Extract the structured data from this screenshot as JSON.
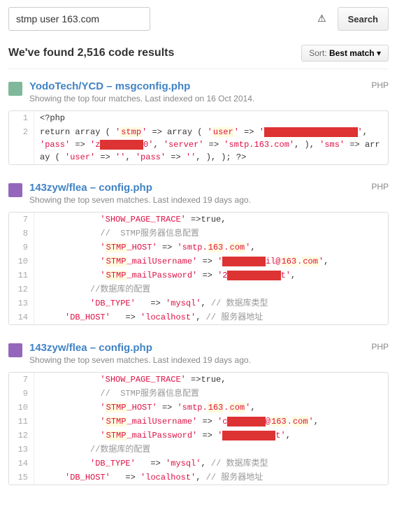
{
  "search": {
    "value": "stmp user 163.com",
    "button": "Search"
  },
  "results_heading": "We've found 2,516 code results",
  "sort": {
    "label": "Sort:",
    "value": "Best match"
  },
  "results": [
    {
      "repo": "YodoTech/YCD",
      "path": "msgconfig.php",
      "sub": "Showing the top four matches. Last indexed on 16 Oct 2014.",
      "lang": "PHP",
      "avatar": "a1",
      "lines": [
        {
          "n": "1",
          "segs": [
            {
              "t": "<?php",
              "c": "tag"
            }
          ]
        },
        {
          "n": "2",
          "segs": [
            {
              "t": "return array ( ",
              "c": "kw"
            },
            {
              "t": "'",
              "c": "str"
            },
            {
              "t": "stmp",
              "c": "str hl"
            },
            {
              "t": "'",
              "c": "str"
            },
            {
              "t": " => array ( ",
              "c": "op"
            },
            {
              "t": "'",
              "c": "str"
            },
            {
              "t": "user",
              "c": "str hl"
            },
            {
              "t": "'",
              "c": "str"
            },
            {
              "t": " => ",
              "c": "op"
            },
            {
              "t": "'",
              "c": "str"
            },
            {
              "t": "██████████████████",
              "c": "red"
            },
            {
              "t": "'",
              "c": "str"
            },
            {
              "t": ", ",
              "c": "op"
            },
            {
              "t": "'pass'",
              "c": "str"
            },
            {
              "t": " => ",
              "c": "op"
            },
            {
              "t": "'z",
              "c": "str"
            },
            {
              "t": "████████",
              "c": "red"
            },
            {
              "t": "0'",
              "c": "str"
            },
            {
              "t": ", ",
              "c": "op"
            },
            {
              "t": "'server'",
              "c": "str"
            },
            {
              "t": " => ",
              "c": "op"
            },
            {
              "t": "'smtp.163.com'",
              "c": "str"
            },
            {
              "t": ", ), ",
              "c": "op"
            },
            {
              "t": "'sms'",
              "c": "str"
            },
            {
              "t": " => array ( ",
              "c": "op"
            },
            {
              "t": "'user'",
              "c": "str"
            },
            {
              "t": " => ",
              "c": "op"
            },
            {
              "t": "''",
              "c": "str"
            },
            {
              "t": ", ",
              "c": "op"
            },
            {
              "t": "'pass'",
              "c": "str"
            },
            {
              "t": " => ",
              "c": "op"
            },
            {
              "t": "''",
              "c": "str"
            },
            {
              "t": ", ), ); ?>",
              "c": "op"
            }
          ]
        }
      ]
    },
    {
      "repo": "143zyw/flea",
      "path": "config.php",
      "sub": "Showing the top seven matches. Last indexed 19 days ago.",
      "lang": "PHP",
      "avatar": "a2",
      "lines": [
        {
          "n": "7",
          "segs": [
            {
              "t": "            ",
              "c": ""
            },
            {
              "t": "'SHOW_PAGE_TRACE'",
              "c": "str"
            },
            {
              "t": " =>true,",
              "c": "op"
            }
          ]
        },
        {
          "n": "8",
          "segs": [
            {
              "t": "            ",
              "c": ""
            },
            {
              "t": "//  STMP服务器信息配置",
              "c": "cm"
            }
          ]
        },
        {
          "n": "9",
          "segs": [
            {
              "t": "            ",
              "c": ""
            },
            {
              "t": "'",
              "c": "str"
            },
            {
              "t": "STMP",
              "c": "str hl"
            },
            {
              "t": "_HOST'",
              "c": "str"
            },
            {
              "t": " => ",
              "c": "op"
            },
            {
              "t": "'smtp.",
              "c": "str"
            },
            {
              "t": "163",
              "c": "str hl"
            },
            {
              "t": ".",
              "c": "str"
            },
            {
              "t": "com",
              "c": "str hl"
            },
            {
              "t": "'",
              "c": "str"
            },
            {
              "t": ",",
              "c": "op"
            }
          ]
        },
        {
          "n": "10",
          "segs": [
            {
              "t": "            ",
              "c": ""
            },
            {
              "t": "'",
              "c": "str"
            },
            {
              "t": "STMP",
              "c": "str hl"
            },
            {
              "t": "_mailUsername'",
              "c": "str"
            },
            {
              "t": " => ",
              "c": "op"
            },
            {
              "t": "'",
              "c": "str"
            },
            {
              "t": "████████",
              "c": "red"
            },
            {
              "t": "il@",
              "c": "str"
            },
            {
              "t": "163",
              "c": "str hl"
            },
            {
              "t": ".",
              "c": "str"
            },
            {
              "t": "com",
              "c": "str hl"
            },
            {
              "t": "'",
              "c": "str"
            },
            {
              "t": ",",
              "c": "op"
            }
          ]
        },
        {
          "n": "11",
          "segs": [
            {
              "t": "            ",
              "c": ""
            },
            {
              "t": "'",
              "c": "str"
            },
            {
              "t": "STMP",
              "c": "str hl"
            },
            {
              "t": "_mailPassword'",
              "c": "str"
            },
            {
              "t": " => ",
              "c": "op"
            },
            {
              "t": "'2",
              "c": "str"
            },
            {
              "t": "██████████",
              "c": "red"
            },
            {
              "t": "t'",
              "c": "str"
            },
            {
              "t": ",",
              "c": "op"
            }
          ]
        },
        {
          "n": "12",
          "segs": [
            {
              "t": "          ",
              "c": ""
            },
            {
              "t": "//数据库的配置",
              "c": "cm"
            }
          ]
        },
        {
          "n": "13",
          "segs": [
            {
              "t": "          ",
              "c": ""
            },
            {
              "t": "'DB_TYPE'",
              "c": "str"
            },
            {
              "t": "   => ",
              "c": "op"
            },
            {
              "t": "'mysql'",
              "c": "str"
            },
            {
              "t": ", ",
              "c": "op"
            },
            {
              "t": "// 数据库类型",
              "c": "cm"
            }
          ]
        },
        {
          "n": "14",
          "segs": [
            {
              "t": "     ",
              "c": ""
            },
            {
              "t": "'DB_HOST'",
              "c": "str"
            },
            {
              "t": "   => ",
              "c": "op"
            },
            {
              "t": "'localhost'",
              "c": "str"
            },
            {
              "t": ", ",
              "c": "op"
            },
            {
              "t": "// 服务器地址",
              "c": "cm"
            }
          ]
        }
      ]
    },
    {
      "repo": "143zyw/flea",
      "path": "config.php",
      "sub": "Showing the top seven matches. Last indexed 19 days ago.",
      "lang": "PHP",
      "avatar": "a2",
      "lines": [
        {
          "n": "7",
          "segs": [
            {
              "t": "            ",
              "c": ""
            },
            {
              "t": "'SHOW_PAGE_TRACE'",
              "c": "str"
            },
            {
              "t": " =>true,",
              "c": "op"
            }
          ]
        },
        {
          "n": "9",
          "segs": [
            {
              "t": "            ",
              "c": ""
            },
            {
              "t": "//  STMP服务器信息配置",
              "c": "cm"
            }
          ]
        },
        {
          "n": "10",
          "segs": [
            {
              "t": "            ",
              "c": ""
            },
            {
              "t": "'",
              "c": "str"
            },
            {
              "t": "STMP",
              "c": "str hl"
            },
            {
              "t": "_HOST'",
              "c": "str"
            },
            {
              "t": " => ",
              "c": "op"
            },
            {
              "t": "'smtp.",
              "c": "str"
            },
            {
              "t": "163",
              "c": "str hl"
            },
            {
              "t": ".",
              "c": "str"
            },
            {
              "t": "com",
              "c": "str hl"
            },
            {
              "t": "'",
              "c": "str"
            },
            {
              "t": ",",
              "c": "op"
            }
          ]
        },
        {
          "n": "11",
          "segs": [
            {
              "t": "            ",
              "c": ""
            },
            {
              "t": "'",
              "c": "str"
            },
            {
              "t": "STMP",
              "c": "str hl"
            },
            {
              "t": "_mailUsername'",
              "c": "str"
            },
            {
              "t": " => ",
              "c": "op"
            },
            {
              "t": "'c",
              "c": "str"
            },
            {
              "t": "███████",
              "c": "red"
            },
            {
              "t": "@",
              "c": "str"
            },
            {
              "t": "163",
              "c": "str hl"
            },
            {
              "t": ".",
              "c": "str"
            },
            {
              "t": "com",
              "c": "str hl"
            },
            {
              "t": "'",
              "c": "str"
            },
            {
              "t": ",",
              "c": "op"
            }
          ]
        },
        {
          "n": "12",
          "segs": [
            {
              "t": "            ",
              "c": ""
            },
            {
              "t": "'",
              "c": "str"
            },
            {
              "t": "STMP",
              "c": "str hl"
            },
            {
              "t": "_mailPassword'",
              "c": "str"
            },
            {
              "t": " => ",
              "c": "op"
            },
            {
              "t": "'",
              "c": "str"
            },
            {
              "t": "██████████",
              "c": "red"
            },
            {
              "t": "t'",
              "c": "str"
            },
            {
              "t": ",",
              "c": "op"
            }
          ]
        },
        {
          "n": "13",
          "segs": [
            {
              "t": "          ",
              "c": ""
            },
            {
              "t": "//数据库的配置",
              "c": "cm"
            }
          ]
        },
        {
          "n": "14",
          "segs": [
            {
              "t": "          ",
              "c": ""
            },
            {
              "t": "'DB_TYPE'",
              "c": "str"
            },
            {
              "t": "   => ",
              "c": "op"
            },
            {
              "t": "'mysql'",
              "c": "str"
            },
            {
              "t": ", ",
              "c": "op"
            },
            {
              "t": "// 数据库类型",
              "c": "cm"
            }
          ]
        },
        {
          "n": "15",
          "segs": [
            {
              "t": "     ",
              "c": ""
            },
            {
              "t": "'DB_HOST'",
              "c": "str"
            },
            {
              "t": "   => ",
              "c": "op"
            },
            {
              "t": "'localhost'",
              "c": "str"
            },
            {
              "t": ", ",
              "c": "op"
            },
            {
              "t": "// 服务器地址",
              "c": "cm"
            }
          ]
        }
      ]
    }
  ]
}
